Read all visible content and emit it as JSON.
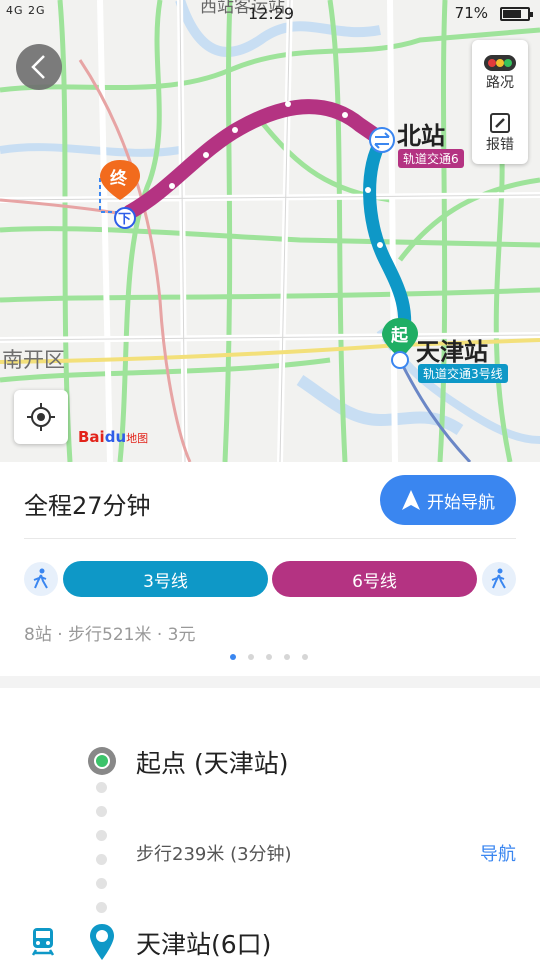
{
  "status": {
    "signal_text": "4G 2G",
    "time": "12:29",
    "battery_pct": "71%",
    "battery_level": 0.71
  },
  "map": {
    "poi_top": "西站客运站",
    "north_station": "北站",
    "north_line": "轨道交通6",
    "tianjin_station": "天津站",
    "tianjin_line": "轨道交通3号线",
    "district": "南开区",
    "end_marker": "终",
    "start_marker": "起",
    "getoff_marker": "下",
    "logo_text": "Bai",
    "logo_du": "du",
    "logo_map": "地图"
  },
  "tools": {
    "traffic_label": "路况",
    "report_label": "报错"
  },
  "route": {
    "total_time": "全程27分钟",
    "start_nav_label": "开始导航",
    "segments": [
      {
        "label": "3号线",
        "color": "#0e98c7"
      },
      {
        "label": "6号线",
        "color": "#b43382"
      }
    ],
    "summary": "8站 · 步行521米 · 3元",
    "page_count": 5,
    "active_page": 0
  },
  "steps": {
    "start_label": "起点 (天津站)",
    "walk_label": "步行239米 (3分钟)",
    "walk_nav": "导航",
    "station_label": "天津站(6口)"
  },
  "colors": {
    "accent": "#3a86f0",
    "line3": "#0e98c7",
    "line6": "#b43382",
    "start_green": "#1fae64",
    "end_orange": "#f26b1d"
  }
}
